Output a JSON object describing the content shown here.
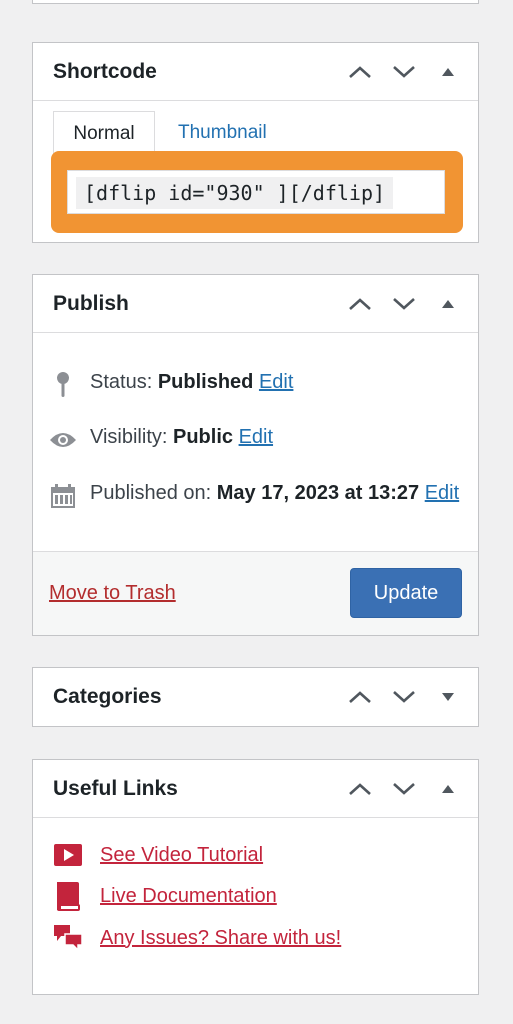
{
  "shortcode": {
    "title": "Shortcode",
    "tabs": [
      {
        "label": "Normal"
      },
      {
        "label": "Thumbnail"
      }
    ],
    "code": "[dflip id=\"930\" ][/dflip]",
    "highlight_color": "#f19433"
  },
  "publish": {
    "title": "Publish",
    "status_label": "Status: ",
    "status_value": "Published",
    "visibility_label": "Visibility: ",
    "visibility_value": "Public",
    "published_label": "Published on: ",
    "published_value": "May 17, 2023 at 13:27",
    "edit_label": "Edit",
    "trash_label": "Move to Trash",
    "update_label": "Update",
    "update_color": "#3a70b4"
  },
  "categories": {
    "title": "Categories"
  },
  "useful_links": {
    "title": "Useful Links",
    "items": [
      {
        "label": "See Video Tutorial",
        "icon": "video-play-icon"
      },
      {
        "label": "Live Documentation",
        "icon": "book-icon"
      },
      {
        "label": "Any Issues? Share with us!",
        "icon": "chat-bubbles-icon"
      }
    ],
    "link_color": "#c3243c"
  }
}
